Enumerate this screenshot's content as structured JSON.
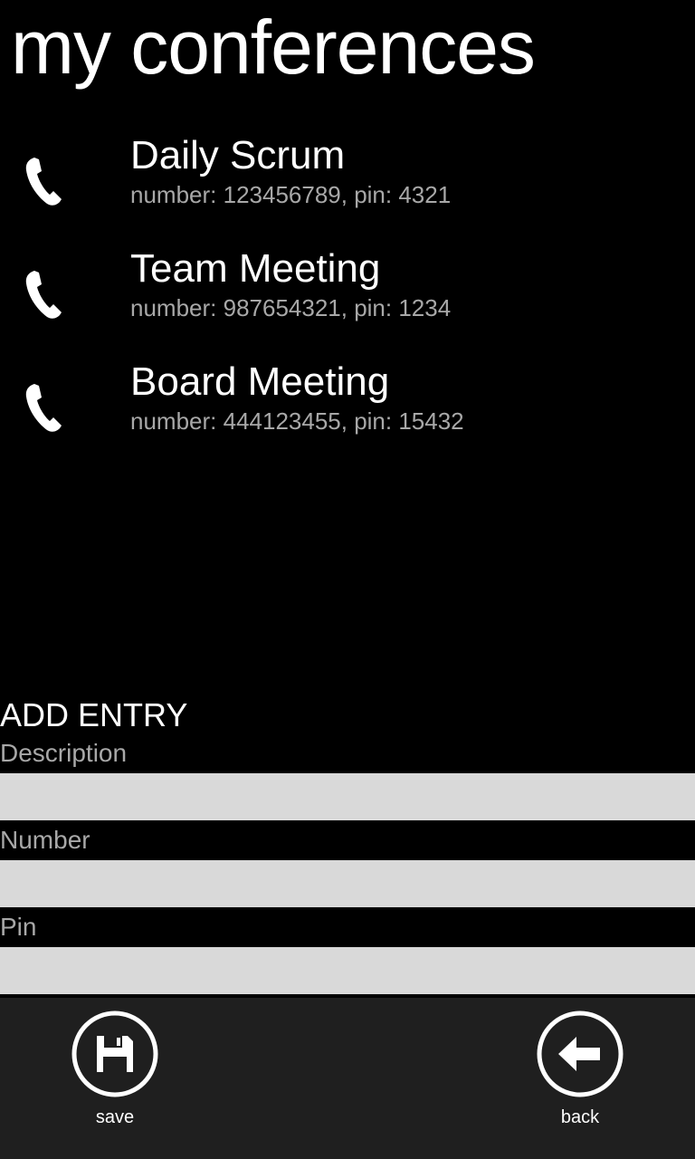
{
  "header": {
    "title": "my conferences"
  },
  "conferences": [
    {
      "name": "Daily Scrum",
      "detail": "number: 123456789, pin: 4321"
    },
    {
      "name": "Team Meeting",
      "detail": "number: 987654321, pin: 1234"
    },
    {
      "name": "Board Meeting",
      "detail": "number: 444123455, pin: 15432"
    }
  ],
  "add_entry": {
    "heading": "ADD ENTRY",
    "description_label": "Description",
    "description_value": "",
    "number_label": "Number",
    "number_value": "",
    "pin_label": "Pin",
    "pin_value": ""
  },
  "app_bar": {
    "save_label": "save",
    "save_icon": "save-icon",
    "back_label": "back",
    "back_icon": "back-arrow-icon"
  },
  "colors": {
    "background": "#000000",
    "text": "#ffffff",
    "secondary_text": "#a8a8a8",
    "input_background": "#d9d9d9",
    "app_bar": "#1f1f1f"
  }
}
